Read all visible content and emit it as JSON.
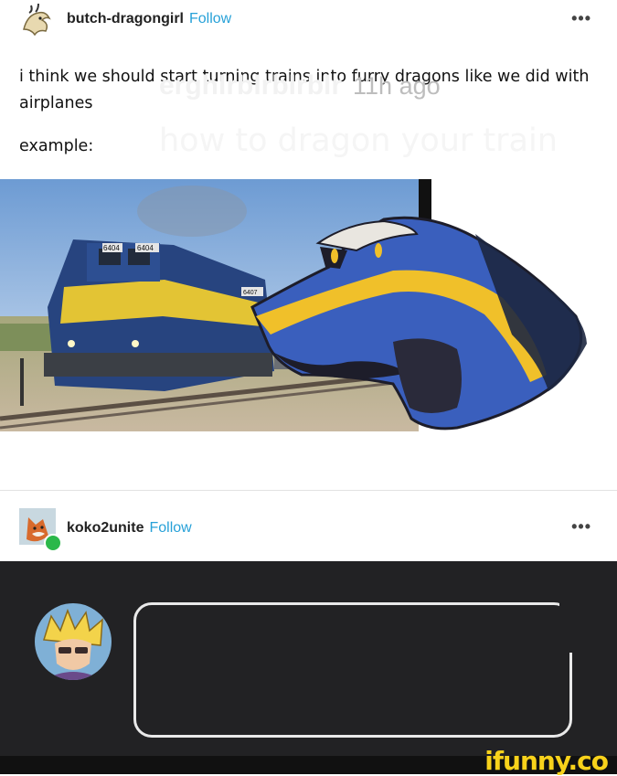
{
  "post": {
    "username": "butch-dragongirl",
    "follow_label": "Follow",
    "more_label": "•••",
    "text_line1": "i think we should start turning trains into furry dragons like we did with",
    "text_line2": "airplanes",
    "text_line3": "example:",
    "train_number_1": "6404",
    "train_number_2": "6404",
    "train_number_3": "6407"
  },
  "reblog": {
    "username": "koko2unite",
    "follow_label": "Follow",
    "more_label": "•••"
  },
  "comment": {
    "author": "erghlrblrblrblr",
    "time": "11h ago",
    "text": "how to dragon your train"
  },
  "watermark": {
    "label": "ifunny.co"
  }
}
